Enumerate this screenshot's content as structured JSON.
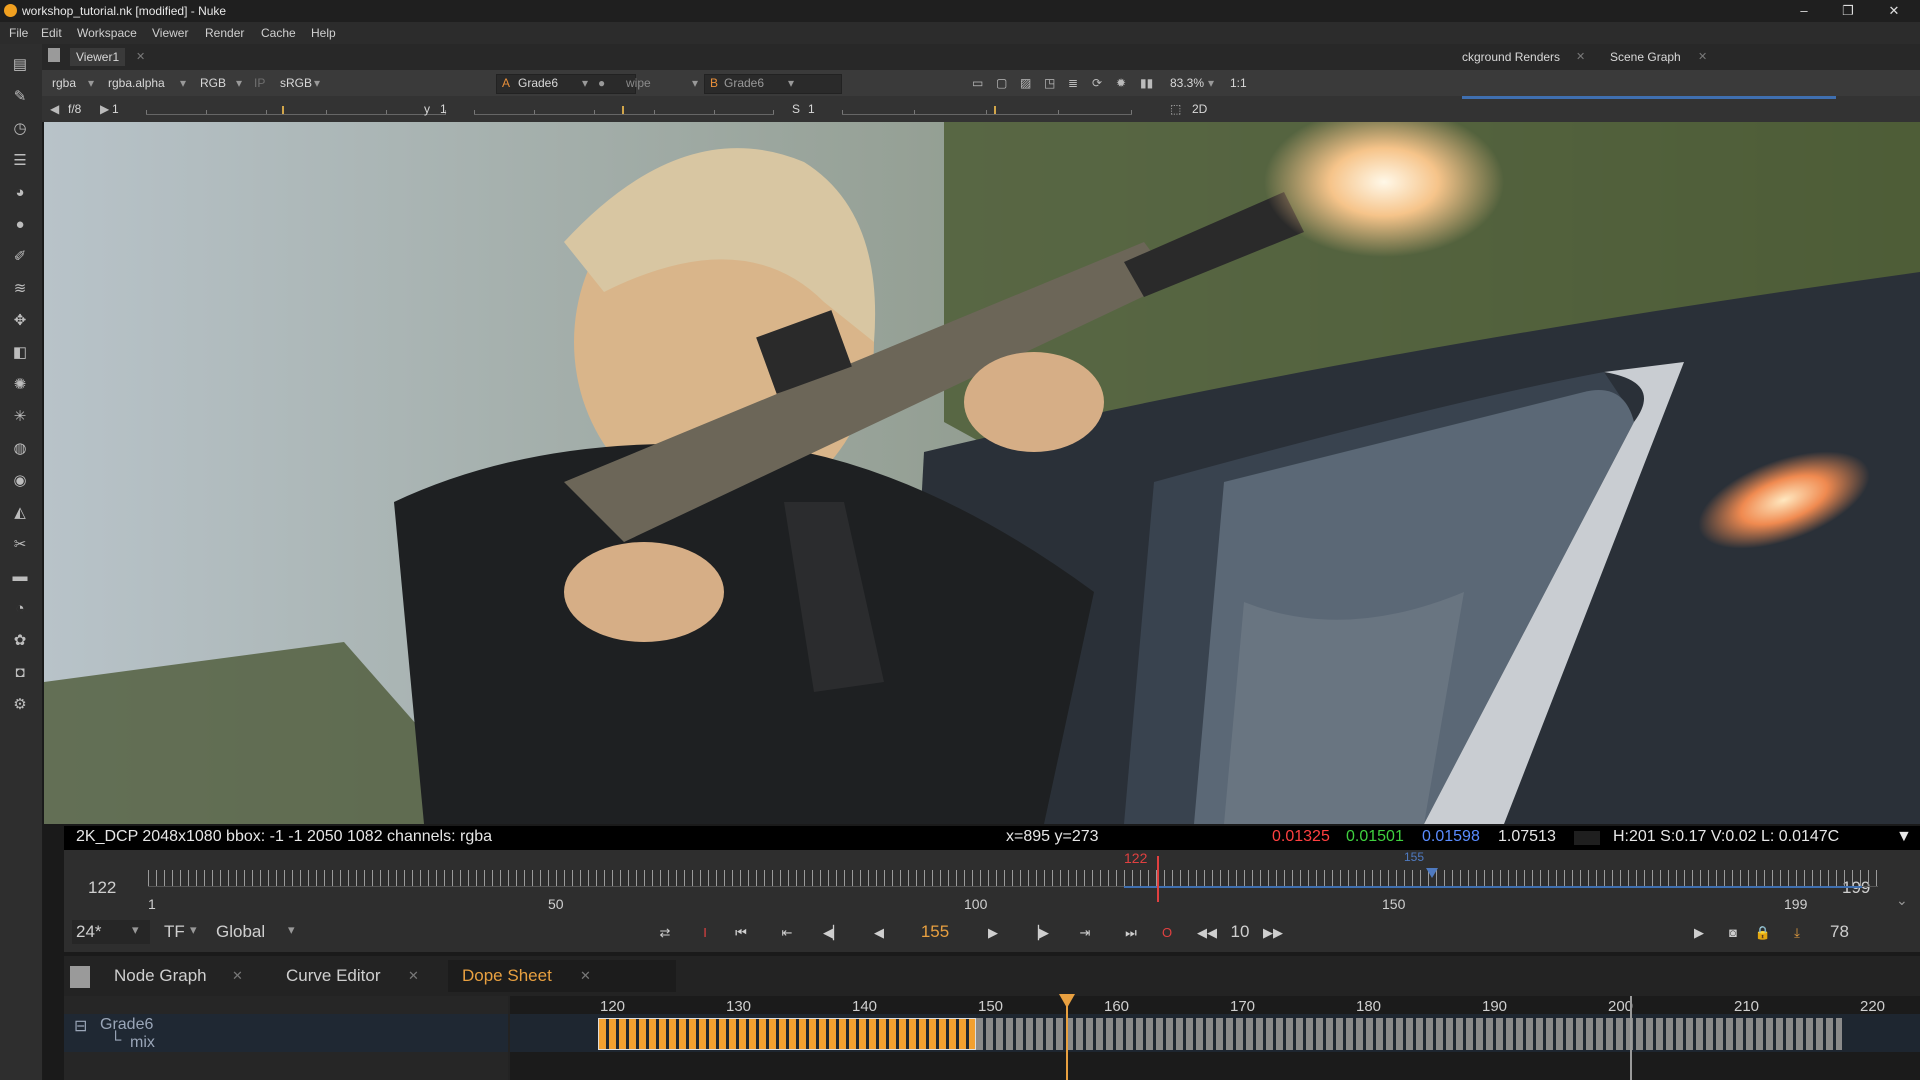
{
  "window": {
    "title": "workshop_tutorial.nk [modified] - Nuke",
    "min": "–",
    "max": "❐",
    "close": "✕"
  },
  "menu": [
    "File",
    "Edit",
    "Workspace",
    "Viewer",
    "Render",
    "Cache",
    "Help"
  ],
  "tabs": {
    "viewer": "Viewer1",
    "bg_renders": "ckground Renders",
    "scene_graph": "Scene Graph"
  },
  "controls": {
    "channels": "rgba",
    "layer": "rgba.alpha",
    "display": "RGB",
    "ip": "IP",
    "lut": "sRGB",
    "a_label": "A",
    "a_input": "Grade6",
    "wipe": "wipe",
    "b_label": "B",
    "b_input": "Grade6",
    "zoom": "83.3%",
    "ratio": "1:1",
    "mode2d": "2D",
    "fstop": "f/8",
    "gain": "1",
    "gamma_label": "y",
    "gamma": "1",
    "sat_label": "S",
    "sat": "1"
  },
  "info": {
    "format": "2K_DCP 2048x1080  bbox: -1 -1 2050 1082 channels: rgba",
    "coords": "x=895 y=273",
    "r": "0.01325",
    "g": "0.01501",
    "b": "0.01598",
    "a": "1.07513",
    "hsv": "H:201 S:0.17 V:0.02  L: 0.0147C",
    "colors": {
      "r": "#ff4040",
      "g": "#3fd13f",
      "b": "#5a8cff"
    }
  },
  "timeline": {
    "start": "122",
    "end": "199",
    "in_label": "122",
    "current_label": "155",
    "ticks": [
      "1",
      "50",
      "100",
      "150",
      "199"
    ],
    "fps": "24*",
    "tf": "TF",
    "global": "Global",
    "current_frame": "155",
    "step": "10",
    "frame_count": "78"
  },
  "bottom": {
    "tabs": [
      "Node Graph",
      "Curve Editor",
      "Dope Sheet"
    ],
    "node": "Grade6",
    "knob": "mix",
    "frames": [
      "120",
      "130",
      "140",
      "150",
      "160",
      "170",
      "180",
      "190",
      "200",
      "210",
      "220"
    ]
  }
}
